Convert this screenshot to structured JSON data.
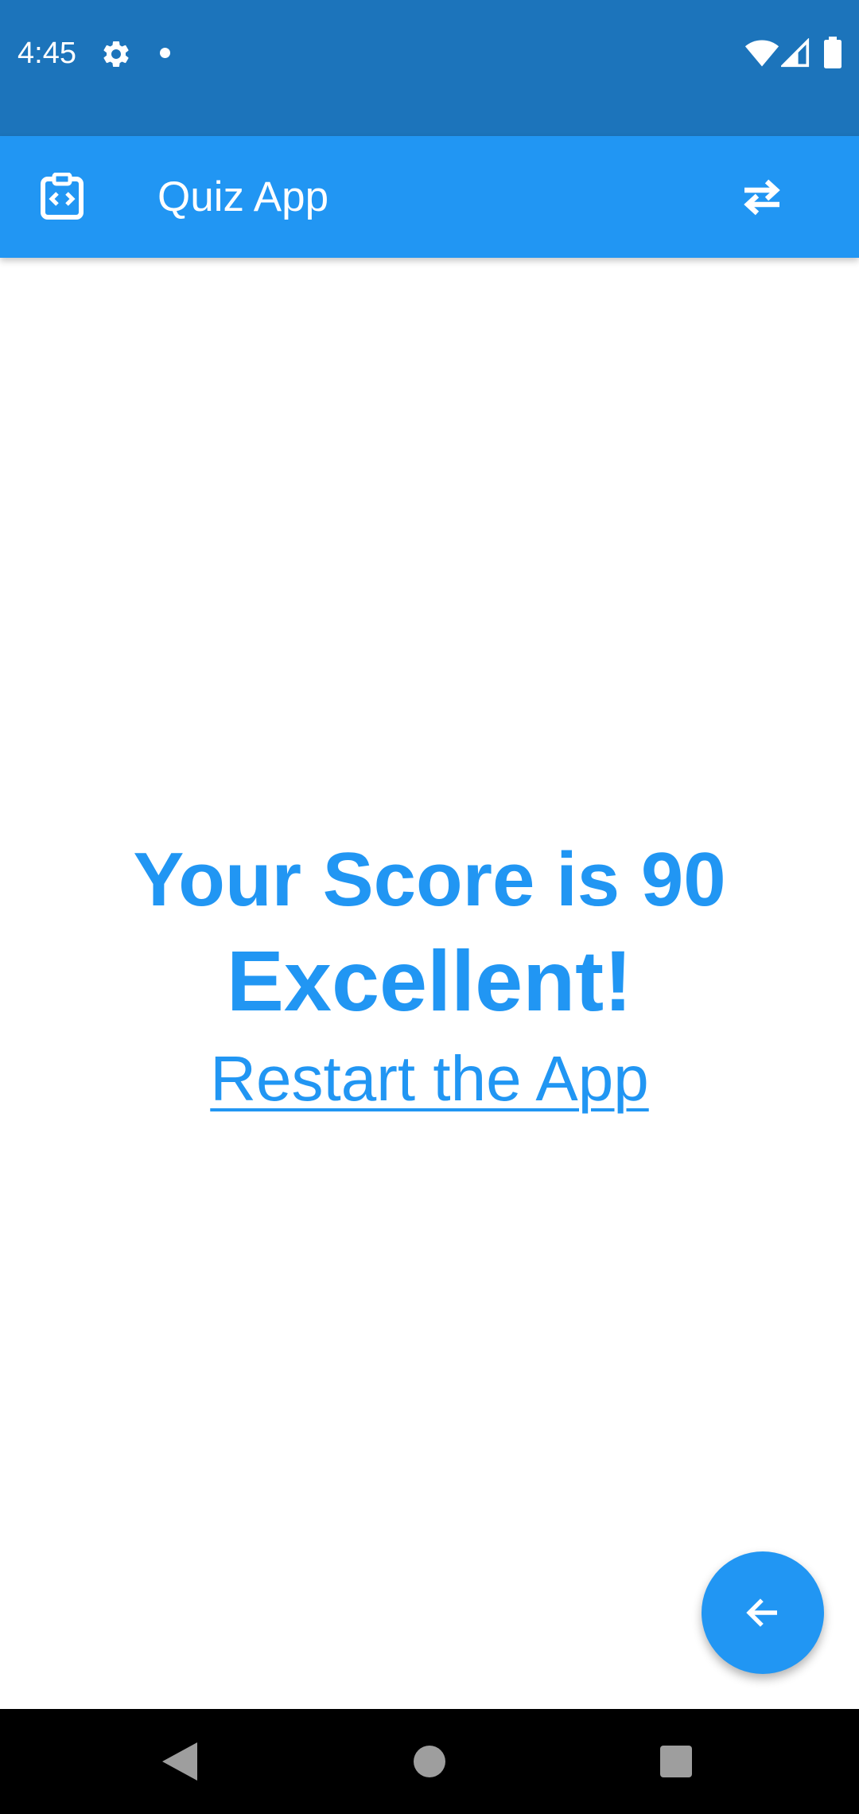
{
  "status_bar": {
    "time": "4:45",
    "icons": [
      "gear-icon",
      "notification-dot-icon",
      "wifi-icon",
      "signal-icon",
      "battery-icon"
    ],
    "background": "#1c74bb"
  },
  "app_bar": {
    "title": "Quiz App",
    "logo_icon": "clipboard-code-icon",
    "action_icon": "swap-arrows-icon",
    "background": "#2196f3"
  },
  "result": {
    "score_text": "Your Score is 90",
    "grade_text": "Excellent!",
    "restart_link": "Restart the App",
    "text_color": "#2196f3"
  },
  "fab": {
    "icon": "arrow-back-icon",
    "background": "#2196f3"
  },
  "nav_bar": {
    "buttons": [
      "back-icon",
      "home-icon",
      "recents-icon"
    ]
  }
}
